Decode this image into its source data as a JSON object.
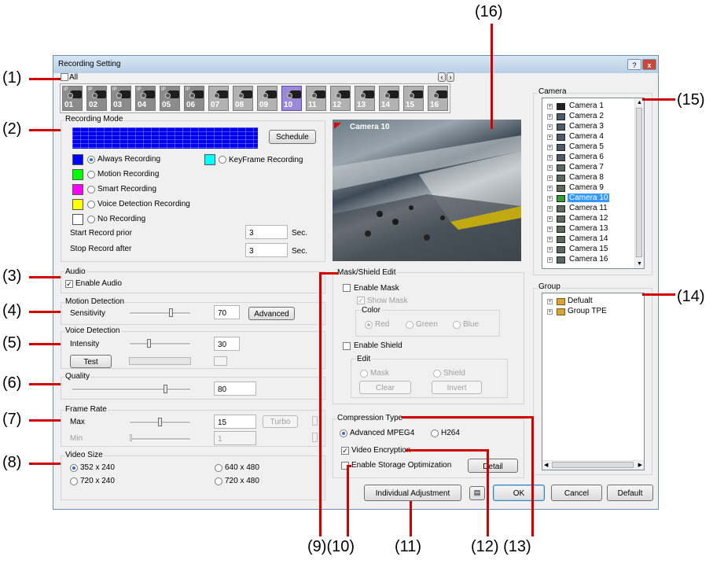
{
  "callouts": [
    "(1)",
    "(2)",
    "(3)",
    "(4)",
    "(5)",
    "(6)",
    "(7)",
    "(8)",
    "(9)",
    "(10)",
    "(11)",
    "(12)",
    "(13)",
    "(14)",
    "(15)",
    "(16)"
  ],
  "window": {
    "title": "Recording Setting",
    "help_icon": "?",
    "close_icon": "x"
  },
  "camera_strip": {
    "all_label": "All",
    "nav_prev": "‹",
    "nav_next": "›",
    "cameras": [
      {
        "num": "01",
        "ip": "IP"
      },
      {
        "num": "02",
        "ip": "IP"
      },
      {
        "num": "03",
        "ip": "IP"
      },
      {
        "num": "04",
        "ip": "IP"
      },
      {
        "num": "05",
        "ip": "IP"
      },
      {
        "num": "06",
        "ip": "IP"
      },
      {
        "num": "07",
        "ip": ""
      },
      {
        "num": "08",
        "ip": ""
      },
      {
        "num": "09",
        "ip": ""
      },
      {
        "num": "10",
        "ip": ""
      },
      {
        "num": "11",
        "ip": ""
      },
      {
        "num": "12",
        "ip": ""
      },
      {
        "num": "13",
        "ip": ""
      },
      {
        "num": "14",
        "ip": ""
      },
      {
        "num": "15",
        "ip": ""
      },
      {
        "num": "16",
        "ip": ""
      }
    ],
    "selected": "10"
  },
  "recording_mode": {
    "title": "Recording Mode",
    "schedule_label": "Schedule",
    "options": [
      {
        "label": "Always Recording",
        "color": "#0000ff",
        "selected": true
      },
      {
        "label": "Motion Recording",
        "color": "#00ff00",
        "selected": false
      },
      {
        "label": "Smart Recording",
        "color": "#ff00ff",
        "selected": false
      },
      {
        "label": "Voice Detection Recording",
        "color": "#ffff00",
        "selected": false
      },
      {
        "label": "No Recording",
        "color": "#ffffff",
        "selected": false
      }
    ],
    "keyframe": {
      "label": "KeyFrame Recording",
      "color": "#00ffff"
    },
    "start_prior_label": "Start Record prior",
    "start_prior_value": "3",
    "stop_after_label": "Stop Record after",
    "stop_after_value": "3",
    "unit": "Sec."
  },
  "audio": {
    "title": "Audio",
    "enable_label": "Enable Audio"
  },
  "motion": {
    "title": "Motion Detection",
    "sensitivity_label": "Sensitivity",
    "value": "70",
    "advanced_label": "Advanced",
    "level": 0.7
  },
  "voice": {
    "title": "Voice Detection",
    "intensity_label": "Intensity",
    "value": "30",
    "test_label": "Test",
    "level": 0.3
  },
  "quality": {
    "title": "Quality",
    "value": "80",
    "level": 0.8
  },
  "frame_rate": {
    "title": "Frame Rate",
    "max_label": "Max",
    "max_value": "15",
    "turbo_label": "Turbo",
    "min_label": "Min",
    "min_value": "1",
    "max_level": 0.5,
    "min_level": 0.0
  },
  "video_size": {
    "title": "Video Size",
    "options": [
      "352 x 240",
      "640 x 480",
      "720 x 240",
      "720 x 480"
    ],
    "selected": "352 x 240"
  },
  "preview": {
    "camera_label": "Camera 10"
  },
  "mask": {
    "title": "Mask/Shield Edit",
    "enable_mask": "Enable Mask",
    "show_mask": "Show Mask",
    "color_title": "Color",
    "colors": [
      "Red",
      "Green",
      "Blue"
    ],
    "enable_shield": "Enable Shield",
    "edit_title": "Edit",
    "edit_options": [
      "Mask",
      "Shield"
    ],
    "clear_label": "Clear",
    "invert_label": "Invert"
  },
  "compression": {
    "title": "Compression Type",
    "options": [
      "Advanced MPEG4",
      "H264"
    ],
    "selected": "Advanced MPEG4",
    "video_encryption": "Video Encryption",
    "storage_opt": "Enable Storage Optimization",
    "detail_label": "Detail"
  },
  "camera_panel": {
    "title": "Camera",
    "items": [
      "Camera 1",
      "Camera 2",
      "Camera 3",
      "Camera 4",
      "Camera 5",
      "Camera 6",
      "Camera 7",
      "Camera 8",
      "Camera 9",
      "Camera 10",
      "Camera 11",
      "Camera 12",
      "Camera 13",
      "Camera 14",
      "Camera 15",
      "Camera 16"
    ],
    "selected": "Camera 10"
  },
  "group_panel": {
    "title": "Group",
    "items": [
      "Defualt",
      "Group TPE"
    ]
  },
  "footer": {
    "individual_label": "Individual Adjustment",
    "ok_label": "OK",
    "cancel_label": "Cancel",
    "default_label": "Default"
  }
}
